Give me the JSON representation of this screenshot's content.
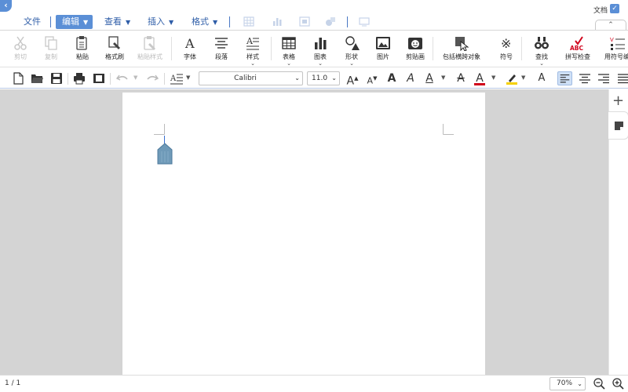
{
  "menubar": {
    "back_icon": "back-arrow-icon",
    "items": [
      {
        "label": "文件",
        "has_dropdown": false
      },
      {
        "label": "编辑",
        "has_dropdown": true,
        "active": true
      },
      {
        "label": "查看",
        "has_dropdown": true
      },
      {
        "label": "插入",
        "has_dropdown": true
      },
      {
        "label": "格式",
        "has_dropdown": true
      }
    ],
    "doc_label": "文档",
    "doc_checked": true
  },
  "ribbon": {
    "items": [
      {
        "label": "剪切",
        "icon": "scissors-icon",
        "enabled": false
      },
      {
        "label": "复制",
        "icon": "copy-icon",
        "enabled": false
      },
      {
        "label": "粘贴",
        "icon": "paste-icon",
        "enabled": true
      },
      {
        "label": "格式刷",
        "icon": "format-painter-icon",
        "enabled": true
      },
      {
        "label": "粘贴样式",
        "icon": "paste-style-icon",
        "enabled": false
      },
      {
        "label": "字体",
        "icon": "font-icon",
        "enabled": true
      },
      {
        "label": "段落",
        "icon": "paragraph-icon",
        "enabled": true
      },
      {
        "label": "样式",
        "icon": "styles-icon",
        "enabled": true,
        "has_dropdown": true
      },
      {
        "label": "表格",
        "icon": "table-icon",
        "enabled": true,
        "has_dropdown": true
      },
      {
        "label": "图表",
        "icon": "chart-icon",
        "enabled": true,
        "has_dropdown": true
      },
      {
        "label": "形状",
        "icon": "shapes-icon",
        "enabled": true,
        "has_dropdown": true
      },
      {
        "label": "图片",
        "icon": "picture-icon",
        "enabled": true
      },
      {
        "label": "剪贴画",
        "icon": "clipart-icon",
        "enabled": true
      },
      {
        "label": "包括横跨对象",
        "icon": "select-objects-icon",
        "enabled": true
      },
      {
        "label": "符号",
        "icon": "symbol-icon",
        "enabled": true
      },
      {
        "label": "查找",
        "icon": "find-icon",
        "enabled": true,
        "has_dropdown": true
      },
      {
        "label": "拼写检查",
        "icon": "spellcheck-icon",
        "enabled": true
      },
      {
        "label": "用符号编",
        "icon": "bullets-icon",
        "enabled": true
      }
    ]
  },
  "toolbar": {
    "font_name": "Calibri",
    "font_size": "11.0",
    "font_color": "#d0021b",
    "highlight_color": "#f5d000",
    "alignment": "left"
  },
  "document": {
    "page_count": "1 / 1"
  },
  "status": {
    "zoom": "70%"
  }
}
